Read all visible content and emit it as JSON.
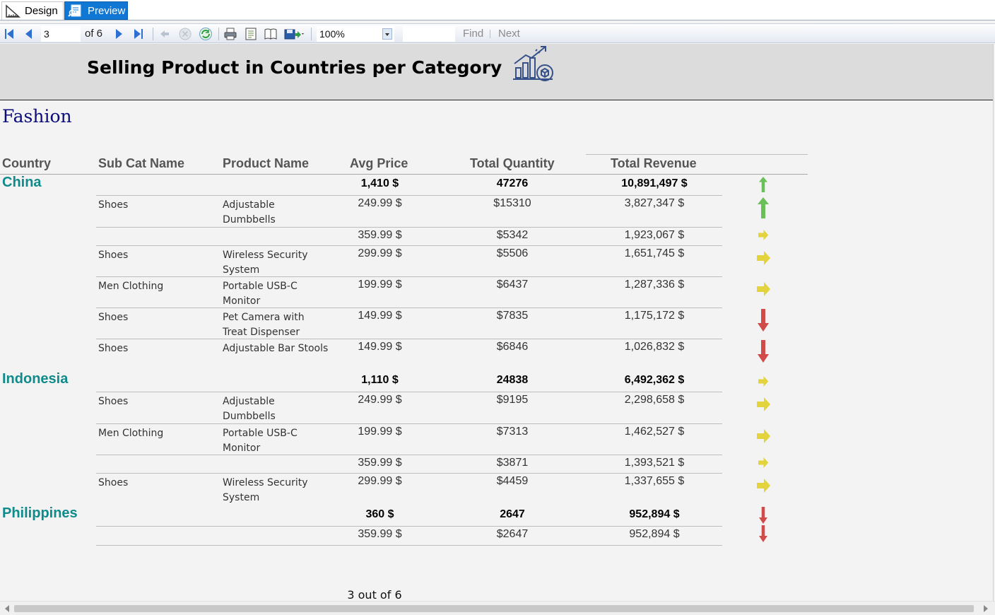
{
  "tabs": {
    "design_label": "Design",
    "preview_label": "Preview"
  },
  "toolbar": {
    "page_current": "3",
    "page_of": "of  6",
    "zoom": "100%",
    "find_value": "",
    "find_label": "Find",
    "next_label": "Next"
  },
  "report": {
    "title": "Selling Product in Countries per Category",
    "category": "Fashion",
    "columns": {
      "country": "Country",
      "subcat": "Sub Cat Name",
      "product": "Product Name",
      "avg": "Avg Price",
      "qty": "Total Quantity",
      "rev": "Total Revenue"
    },
    "groups": [
      {
        "country": "China",
        "avg": "1,410 $",
        "qty": "47276",
        "rev": "10,891,497 $",
        "trend": "up",
        "rows": [
          {
            "subcat": "Shoes",
            "product": "Adjustable Dumbbells",
            "avg": "249.99 $",
            "qty": "$15310",
            "rev": "3,827,347 $",
            "trend": "up"
          },
          {
            "subcat": "",
            "product": "",
            "avg": "359.99 $",
            "qty": "$5342",
            "rev": "1,923,067 $",
            "trend": "flat"
          },
          {
            "subcat": "Shoes",
            "product": "Wireless Security System",
            "avg": "299.99 $",
            "qty": "$5506",
            "rev": "1,651,745 $",
            "trend": "flat"
          },
          {
            "subcat": "Men Clothing",
            "product": "Portable USB-C Monitor",
            "avg": "199.99 $",
            "qty": "$6437",
            "rev": "1,287,336 $",
            "trend": "flat"
          },
          {
            "subcat": "Shoes",
            "product": "Pet Camera with Treat Dispenser",
            "avg": "149.99 $",
            "qty": "$7835",
            "rev": "1,175,172 $",
            "trend": "down"
          },
          {
            "subcat": "Shoes",
            "product": "Adjustable Bar Stools",
            "avg": "149.99 $",
            "qty": "$6846",
            "rev": "1,026,832 $",
            "trend": "down"
          }
        ]
      },
      {
        "country": "Indonesia",
        "avg": "1,110 $",
        "qty": "24838",
        "rev": "6,492,362 $",
        "trend": "flat",
        "rows": [
          {
            "subcat": "Shoes",
            "product": "Adjustable Dumbbells",
            "avg": "249.99 $",
            "qty": "$9195",
            "rev": "2,298,658 $",
            "trend": "flat"
          },
          {
            "subcat": "Men Clothing",
            "product": "Portable USB-C Monitor",
            "avg": "199.99 $",
            "qty": "$7313",
            "rev": "1,462,527 $",
            "trend": "flat"
          },
          {
            "subcat": "",
            "product": "",
            "avg": "359.99 $",
            "qty": "$3871",
            "rev": "1,393,521 $",
            "trend": "flat"
          },
          {
            "subcat": "Shoes",
            "product": "Wireless Security System",
            "avg": "299.99 $",
            "qty": "$4459",
            "rev": "1,337,655 $",
            "trend": "flat"
          }
        ]
      },
      {
        "country": "Philippines",
        "avg": "360 $",
        "qty": "2647",
        "rev": "952,894 $",
        "trend": "down",
        "rows": [
          {
            "subcat": "",
            "product": "",
            "avg": "359.99 $",
            "qty": "$2647",
            "rev": "952,894 $",
            "trend": "down"
          }
        ]
      }
    ],
    "page_footer": "3 out of 6"
  },
  "colors": {
    "country": "#108a8a",
    "category": "#0b0b7a",
    "up": "#6bbf59",
    "flat": "#e3d33c",
    "down": "#d24b4b"
  }
}
